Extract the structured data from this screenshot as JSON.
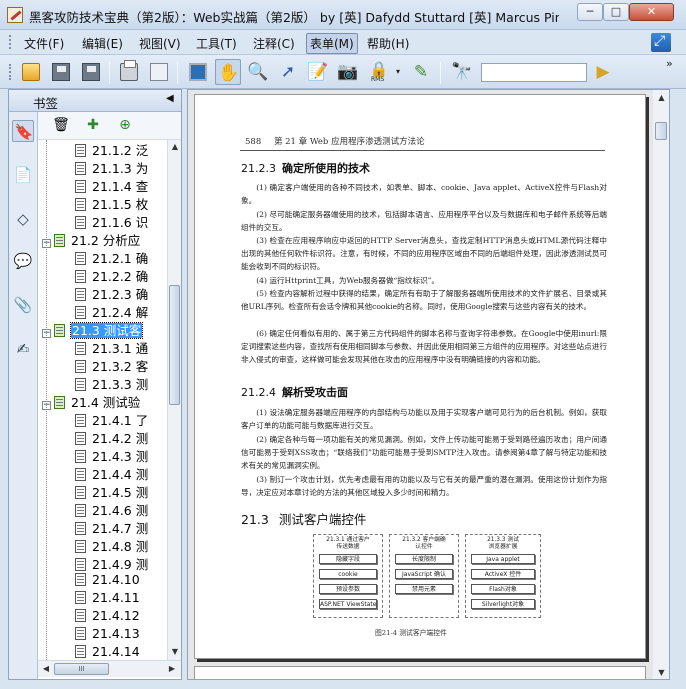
{
  "window": {
    "title": "黑客攻防技术宝典（第2版）：Web实战篇（第2版） by [英] Dafydd Stuttard  [英] Marcus Pinto ...",
    "min": "─",
    "max": "□",
    "close": "✕"
  },
  "menu": {
    "items": [
      "文件(F)",
      "编辑(E)",
      "视图(V)",
      "工具(T)",
      "注释(C)",
      "表单(M)",
      "帮助(H)"
    ]
  },
  "toolbar": {
    "buttons": [
      {
        "name": "open-icon"
      },
      {
        "name": "save-icon"
      },
      {
        "name": "save-as-icon"
      },
      {
        "name": "print-icon"
      },
      {
        "name": "scan-icon"
      },
      {
        "name": "fullscreen-icon"
      },
      {
        "name": "hand-tool-icon"
      },
      {
        "name": "zoom-icon"
      },
      {
        "name": "select-arrow-icon"
      },
      {
        "name": "text-select-icon"
      },
      {
        "name": "snapshot-icon"
      },
      {
        "name": "rms-lock-icon"
      },
      {
        "name": "sign-pen-icon"
      },
      {
        "name": "binoculars-icon"
      }
    ],
    "rms_label": "RMS",
    "find_value": "",
    "more": "»"
  },
  "bookmarks": {
    "title": "书签",
    "collapse": "◀",
    "nodes": [
      {
        "label": "21.1.2 泛",
        "level": 2
      },
      {
        "label": "21.1.3 为",
        "level": 2
      },
      {
        "label": "21.1.4 查",
        "level": 2
      },
      {
        "label": "21.1.5 枚",
        "level": 2
      },
      {
        "label": "21.1.6 识",
        "level": 2
      },
      {
        "label": "21.2 分析应",
        "level": 1,
        "toggle": "−"
      },
      {
        "label": "21.2.1 确",
        "level": 2
      },
      {
        "label": "21.2.2 确",
        "level": 2
      },
      {
        "label": "21.2.3 确",
        "level": 2
      },
      {
        "label": "21.2.4 解",
        "level": 2
      },
      {
        "label": "21.3 测试客",
        "level": 1,
        "toggle": "−",
        "selected": true
      },
      {
        "label": "21.3.1 通",
        "level": 2
      },
      {
        "label": "21.3.2 客",
        "level": 2
      },
      {
        "label": "21.3.3 测",
        "level": 2
      },
      {
        "label": "21.4 测试验",
        "level": 1,
        "toggle": "−"
      },
      {
        "label": "21.4.1 了",
        "level": 2
      },
      {
        "label": "21.4.2 测",
        "level": 2
      },
      {
        "label": "21.4.3 测",
        "level": 2
      },
      {
        "label": "21.4.4 测",
        "level": 2
      },
      {
        "label": "21.4.5 测",
        "level": 2
      },
      {
        "label": "21.4.6 测",
        "level": 2
      },
      {
        "label": "21.4.7 测",
        "level": 2
      },
      {
        "label": "21.4.8 测",
        "level": 2
      },
      {
        "label": "21.4.9 测",
        "level": 2
      },
      {
        "label": "21.4.10",
        "level": 2
      },
      {
        "label": "21.4.11",
        "level": 2
      },
      {
        "label": "21.4.12",
        "level": 2
      },
      {
        "label": "21.4.13",
        "level": 2
      },
      {
        "label": "21.4.14",
        "level": 2
      }
    ],
    "hscroll_grip": "III"
  },
  "page": {
    "running_page": "588",
    "running_title": "第 21 章   Web 应用程序渗透测试方法论",
    "sec_2123": {
      "num": "21.2.3",
      "title": "确定所使用的技术"
    },
    "p1": "(1) 确定客户端使用的各种不同技术，如表单、脚本、cookie、Java applet、ActiveX控件与Flash对象。",
    "p2": "(2) 尽可能确定服务器端使用的技术，包括脚本语言、应用程序平台以及与数据库和电子邮件系统等后端组件的交互。",
    "p3": "(3) 检查在应用程序响应中返回的HTTP Server消息头，查找定制HTTP消息头或HTML源代码注释中出现的其他任何软件标识符。注意，有时候，不同的应用程序区域由不同的后端组件处理，因此渗透测试员可能会收到不同的标识符。",
    "p4": "(4) 运行Httprint工具，为Web服务器做“指纹标识”。",
    "p5": "(5) 检查内容解析过程中获得的结果，确定所有有助于了解服务器端所使用技术的文件扩展名、目录或其他URL序列。检查所有会话令牌和其他cookie的名称。同时，使用Google搜索与这些内容有关的技术。",
    "p6": "(6) 确定任何看似有用的、属于第三方代码组件的脚本名称与查询字符串参数。在Google中使用inurl:限定词搜索这些内容，查找所有使用相同脚本与参数、并因此使用相同第三方组件的应用程序。对这些站点进行非入侵式的审查，这样做可能会发现其他在攻击的应用程序中没有明确链接的内容和功能。",
    "sec_2124": {
      "num": "21.2.4",
      "title": "解析受攻击面"
    },
    "q1": "(1) 设法确定服务器端应用程序的内部结构与功能以及用于实现客户端可见行为的后台机制。例如，获取客户订单的功能可能与数据库进行交互。",
    "q2": "(2) 确定各种与每一项功能有关的常见漏洞。例如，文件上传功能可能易于受到路径遍历攻击；用户间通信可能易于受到XSS攻击；“联络我们”功能可能易于受到SMTP注入攻击。请参阅第4章了解与特定功能和技术有关的常见漏洞实例。",
    "q3": "(3) 制订一个攻击计划，优先考虑最有用的功能以及与它有关的最严重的潜在漏洞。使用这份计划作为指导，决定应对本章讨论的方法的其他区域投入多少时间和精力。",
    "sec_213": {
      "num": "21.3",
      "title": "测试客户端控件"
    },
    "figure": {
      "groups": [
        {
          "title": "21.3.1 通过客户\n传送数据",
          "items": [
            "隐藏字段",
            "cookie",
            "预设参数",
            "ASP.NET ViewState"
          ]
        },
        {
          "title": "21.3.2 客户端确\n认控件",
          "items": [
            "长度限制",
            "JavaScript 确认",
            "禁用元素"
          ]
        },
        {
          "title": "21.3.3 测试\n浏览器扩展",
          "items": [
            "Java applet",
            "ActiveX 控件",
            "Flash对象",
            "Silverlight对象"
          ]
        }
      ],
      "caption": "图21-4   测试客户端控件"
    }
  }
}
